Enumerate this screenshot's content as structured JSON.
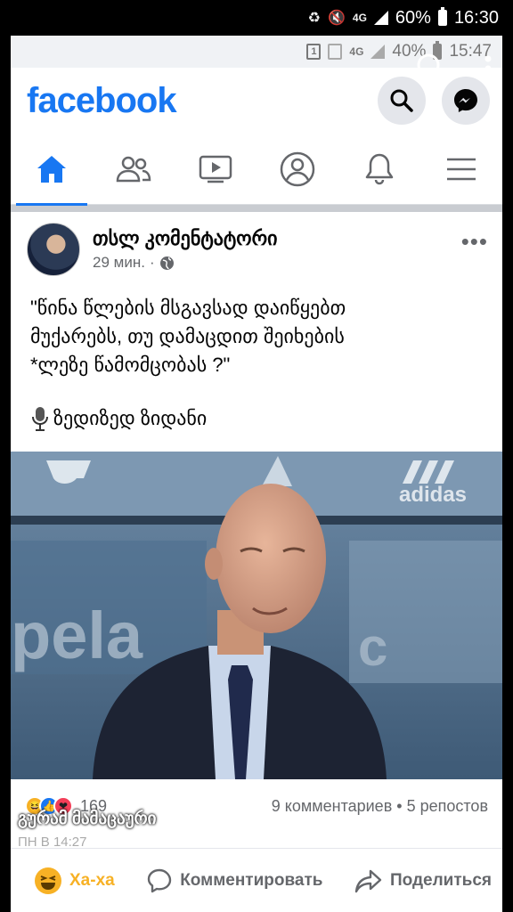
{
  "outer_status": {
    "network": "4G",
    "battery": "60%",
    "time": "16:30"
  },
  "inner_status": {
    "network": "4G",
    "battery": "40%",
    "time": "15:47"
  },
  "app": {
    "logo": "facebook",
    "accent": "#1877f2"
  },
  "nav_tabs": [
    {
      "icon": "home-icon",
      "active": true
    },
    {
      "icon": "friends-icon"
    },
    {
      "icon": "watch-icon"
    },
    {
      "icon": "profile-icon"
    },
    {
      "icon": "bell-icon"
    },
    {
      "icon": "menu-icon"
    }
  ],
  "post": {
    "author": "თსლ კომენტატორი",
    "time": "29 мин.",
    "text": "\"წინა წლების მსგავსად დაიწყებთ\nმუქარებს, თუ დამაცდით შეიხების\n*ლეზე წამომცობას ?\"",
    "signature": "ზედიზედ ზიდანი",
    "reaction_count": "169",
    "comments_label": "9 комментариев",
    "shares_label": "5 репостов"
  },
  "commenter": {
    "name": "გურამ მამაცაური",
    "time": "ПН В 14:27"
  },
  "actions": {
    "reaction_label": "Ха-ха",
    "comment_label": "Комментировать",
    "share_label": "Поделиться"
  }
}
